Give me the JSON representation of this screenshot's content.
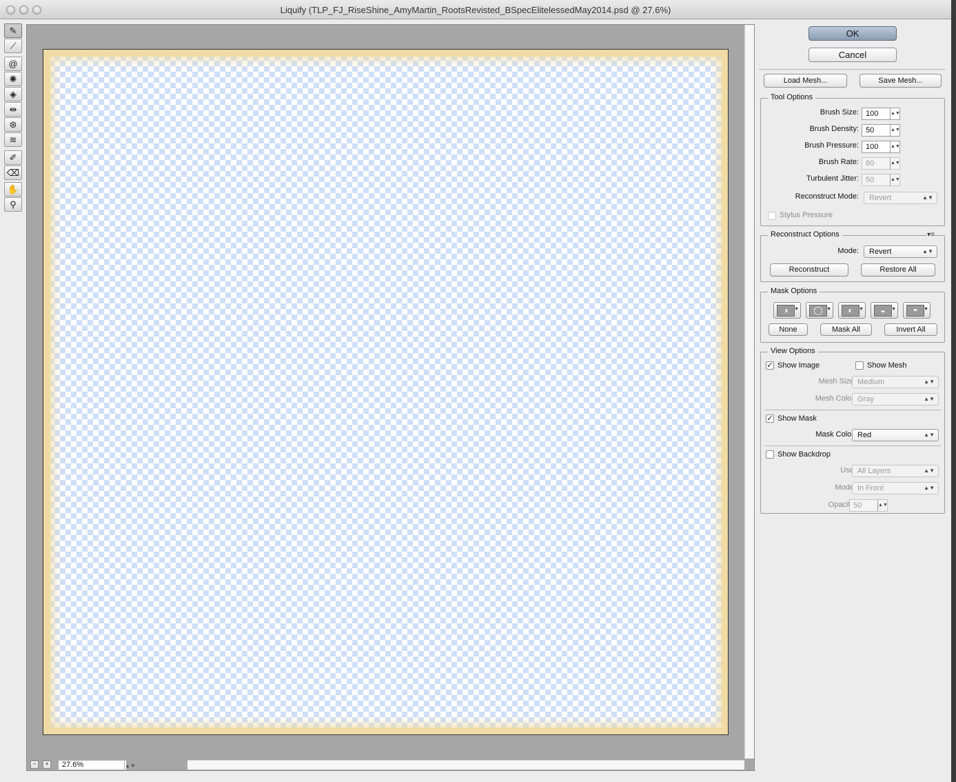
{
  "window": {
    "title": "Liquify (TLP_FJ_RiseShine_AmyMartin_RootsRevisted_BSpecElitelessedMay2014.psd @ 27.6%)"
  },
  "tools": [
    "forward-warp-icon",
    "reconstruct-icon",
    "twirl-icon",
    "pucker-icon",
    "bloat-icon",
    "push-left-icon",
    "mirror-icon",
    "turbulence-icon",
    "freeze-mask-icon",
    "thaw-mask-icon",
    "hand-icon",
    "zoom-icon"
  ],
  "zoom": {
    "value": "27.6%",
    "minus": "−",
    "plus": "+"
  },
  "buttons": {
    "ok": "OK",
    "cancel": "Cancel",
    "load_mesh": "Load Mesh...",
    "save_mesh": "Save Mesh..."
  },
  "tool_options": {
    "legend": "Tool Options",
    "brush_size": {
      "label": "Brush Size:",
      "value": "100"
    },
    "brush_density": {
      "label": "Brush Density:",
      "value": "50"
    },
    "brush_pressure": {
      "label": "Brush Pressure:",
      "value": "100"
    },
    "brush_rate": {
      "label": "Brush Rate:",
      "value": "80"
    },
    "turbulent_jitter": {
      "label": "Turbulent Jitter:",
      "value": "50"
    },
    "reconstruct_mode": {
      "label": "Reconstruct Mode:",
      "value": "Revert"
    },
    "stylus_pressure": {
      "label": "Stylus Pressure",
      "checked": false
    }
  },
  "reconstruct_options": {
    "legend": "Reconstruct Options",
    "mode_label": "Mode:",
    "mode_value": "Revert",
    "reconstruct": "Reconstruct",
    "restore_all": "Restore All"
  },
  "mask_options": {
    "legend": "Mask Options",
    "none": "None",
    "mask_all": "Mask All",
    "invert_all": "Invert All"
  },
  "view_options": {
    "legend": "View Options",
    "show_image": {
      "label": "Show Image",
      "checked": true
    },
    "show_mesh": {
      "label": "Show Mesh",
      "checked": false
    },
    "mesh_size": {
      "label": "Mesh Size:",
      "value": "Medium"
    },
    "mesh_color": {
      "label": "Mesh Color:",
      "value": "Gray"
    },
    "show_mask": {
      "label": "Show Mask",
      "checked": true
    },
    "mask_color": {
      "label": "Mask Color:",
      "value": "Red"
    },
    "show_backdrop": {
      "label": "Show Backdrop",
      "checked": false
    },
    "use": {
      "label": "Use:",
      "value": "All Layers"
    },
    "mode": {
      "label": "Mode:",
      "value": "In Front"
    },
    "opacity": {
      "label": "Opacity:",
      "value": "50"
    }
  },
  "glyphs": {
    "check": "✓",
    "stepper": "▲▼",
    "select_arrow": "▲▼",
    "menu": "▾≡"
  }
}
